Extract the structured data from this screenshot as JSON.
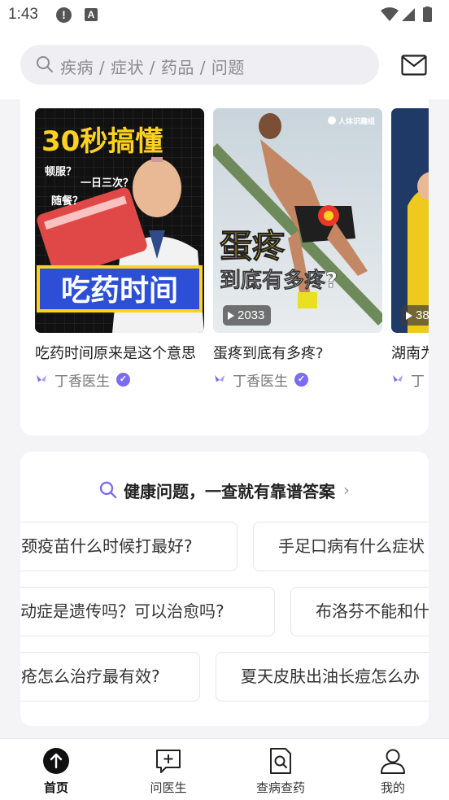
{
  "status_bar": {
    "time": "1:43",
    "alert_glyph": "!",
    "a_glyph": "A",
    "icons": [
      "alert-icon",
      "a-icon",
      "wifi-icon",
      "signal-icon",
      "battery-icon"
    ]
  },
  "header": {
    "search_placeholder": "疾病 / 症状 / 药品 / 问题",
    "icons": [
      "search-icon",
      "mail-icon"
    ]
  },
  "videos": [
    {
      "title": "吃药时间原来是这个意思",
      "author": "丁香医生",
      "thumb_text_main": "30秒搞懂",
      "thumb_text_sub": "吃药时间",
      "thumb_bubble_1": "顿服？",
      "thumb_bubble_2": "一日三次？",
      "thumb_bubble_3": "随餐？",
      "play_count": ""
    },
    {
      "title": "蛋疼到底有多疼?",
      "author": "丁香医生",
      "thumb_text_main": "蛋疼",
      "thumb_text_sub": "到底有多疼?",
      "thumb_corner": "人体识趣组",
      "play_count": "2033"
    },
    {
      "title": "湖南为什么来看看",
      "author": "丁",
      "play_count": "38"
    }
  ],
  "qa": {
    "heading": "健康问题，一查就有靠谱答案",
    "chevron": "›",
    "rows": [
      [
        "宫颈疫苗什么时候打最好?",
        "手足口病有什么症状"
      ],
      [
        "多动症是遗传吗？可以治愈吗?",
        "布洛芬不能和什么"
      ],
      [
        "痔疮怎么治疗最有效?",
        "夏天皮肤出油长痘怎么办"
      ]
    ]
  },
  "bottom_nav": [
    {
      "label": "首页",
      "icon": "home-upload-icon",
      "active": true
    },
    {
      "label": "问医生",
      "icon": "chat-plus-icon",
      "active": false
    },
    {
      "label": "查病查药",
      "icon": "document-search-icon",
      "active": false
    },
    {
      "label": "我的",
      "icon": "person-icon",
      "active": false
    }
  ],
  "colors": {
    "accent": "#7b6cf0",
    "thumb1_yellow": "#ffd21f",
    "thumb1_blue": "#2c4fd6",
    "thumb2_yellow": "#ffd21f"
  }
}
